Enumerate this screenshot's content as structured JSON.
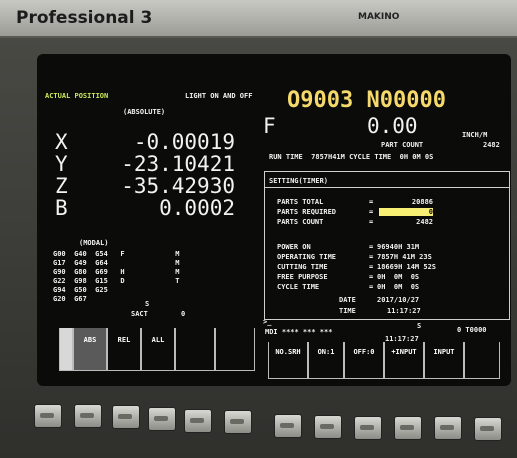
{
  "brand": {
    "title": "Professional  3",
    "maker": "MAKINO"
  },
  "screen": {
    "actual_position_label": "ACTUAL POSITION",
    "absolute_label": "(ABSOLUTE)",
    "light_label": "LIGHT ON AND OFF",
    "program": "O9003 N00000",
    "axes": [
      {
        "name": "X",
        "value": "-0.00019"
      },
      {
        "name": "Y",
        "value": "-23.10421"
      },
      {
        "name": "Z",
        "value": "-35.42930"
      },
      {
        "name": "B",
        "value": "0.0002"
      }
    ],
    "feed_label": "F",
    "feed_value": "0.00",
    "feed_unit": "INCH/M",
    "part_count_label": "PART COUNT",
    "part_count_value": "2482",
    "run_time_text": "RUN TIME  7857H41M CYCLE TIME  0H 0M 0S",
    "modal_label": "(MODAL)",
    "modal_rows": [
      "G00  G40  G54   F            M",
      "G17  G49  G64                M",
      "G90  G80  G69   H            M",
      "G22  G98  G15   D            T",
      "G94  G50  G25",
      "G20  G67"
    ],
    "s_label": "S",
    "sact_label": "SACT",
    "sact_value": "0",
    "setting_title": "SETTING(TIMER)",
    "settings_a": [
      {
        "label": "PARTS TOTAL",
        "value": "20886"
      },
      {
        "label": "PARTS REQUIRED",
        "value": "0"
      },
      {
        "label": "PARTS COUNT",
        "value": "2482"
      }
    ],
    "settings_b": [
      {
        "label": "POWER ON",
        "value": "96940H 31M"
      },
      {
        "label": "OPERATING TIME",
        "value": "7857H 41M 23S"
      },
      {
        "label": "CUTTING TIME",
        "value": "18669H 14M 52S"
      },
      {
        "label": "FREE PURPOSE",
        "value": "0H  0M  0S"
      },
      {
        "label": "CYCLE TIME",
        "value": "0H  0M  0S"
      }
    ],
    "date_label": "DATE",
    "date_value": "2017/10/27",
    "time_label": "TIME",
    "time_value": "11:17:27",
    "prompt": ">_",
    "mdi_text": "MDI **** *** ***",
    "status_s": "S",
    "status_t": "0 T0000",
    "clock2": "11:17:27",
    "softkeys_left": [
      "",
      "ABS",
      "REL",
      "ALL",
      "",
      ""
    ],
    "softkeys_right": [
      "NO.SRH",
      "ON:1",
      "OFF:0",
      "+INPUT",
      "INPUT",
      ""
    ],
    "colors": {
      "accent": "#c8e85a",
      "yellow": "#f5d96b",
      "highlight": "#f8f074"
    }
  }
}
